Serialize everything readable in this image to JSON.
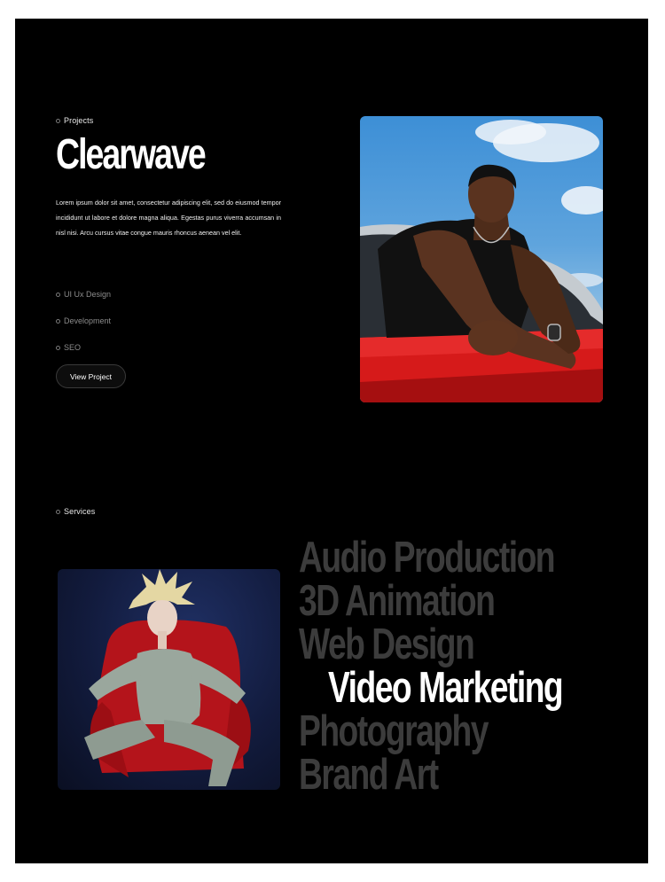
{
  "projects": {
    "section_label": "Projects",
    "title": "Clearwave",
    "description": "Lorem ipsum dolor sit amet, consectetur adipiscing elit, sed do eiusmod tempor incididunt ut labore et dolore magna aliqua. Egestas purus viverra accumsan in nisl nisi. Arcu cursus vitae congue mauris rhoncus aenean vel elit.",
    "tags": [
      "UI Ux Design",
      "Development",
      "SEO"
    ],
    "button_label": "View Project",
    "image_icon": "project-photo-icon"
  },
  "services": {
    "section_label": "Services",
    "items": [
      "Audio Production",
      "3D Animation",
      "Web Design",
      "Video Marketing",
      "Photography",
      "Brand Art"
    ],
    "active_item": "Video Marketing",
    "image_icon": "services-photo-icon"
  },
  "colors": {
    "background": "#000000",
    "text_primary": "#ffffff",
    "text_muted": "#8c8c8c",
    "service_inactive": "#3c3c3c"
  }
}
